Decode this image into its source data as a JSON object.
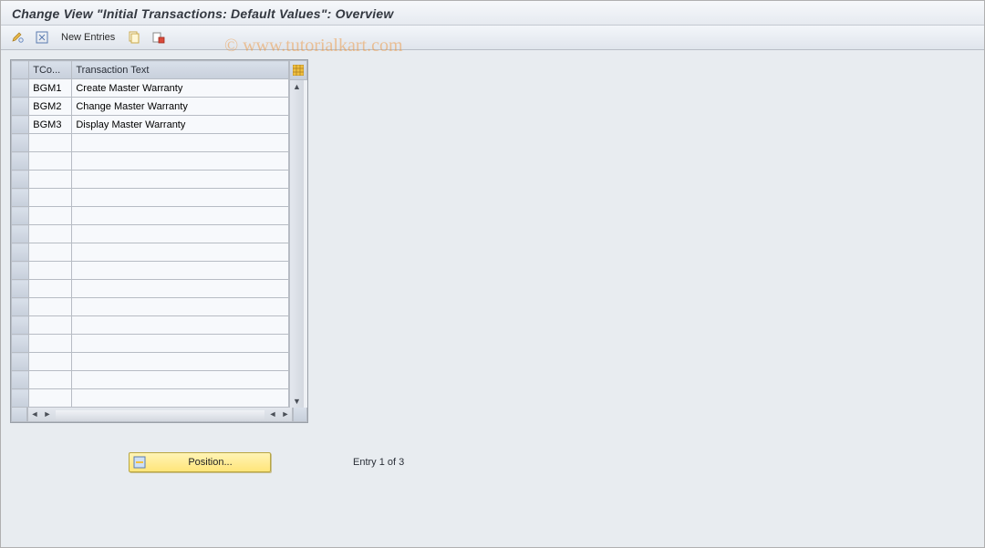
{
  "header": {
    "title": "Change View \"Initial Transactions: Default Values\": Overview"
  },
  "toolbar": {
    "icons": {
      "pencil": "pencil-glasses-icon",
      "expand": "expand-icon",
      "copy": "copy-icon",
      "delete": "delete-icon"
    },
    "new_entries_label": "New Entries"
  },
  "grid": {
    "columns": {
      "tcode": "TCo...",
      "text": "Transaction Text"
    },
    "rows": [
      {
        "tcode": "BGM1",
        "text": "Create Master Warranty"
      },
      {
        "tcode": "BGM2",
        "text": "Change Master Warranty"
      },
      {
        "tcode": "BGM3",
        "text": "Display Master Warranty"
      }
    ],
    "empty_rows": 15
  },
  "position_button": {
    "label": "Position..."
  },
  "entry_status": "Entry 1 of 3",
  "watermark": "© www.tutorialkart.com"
}
